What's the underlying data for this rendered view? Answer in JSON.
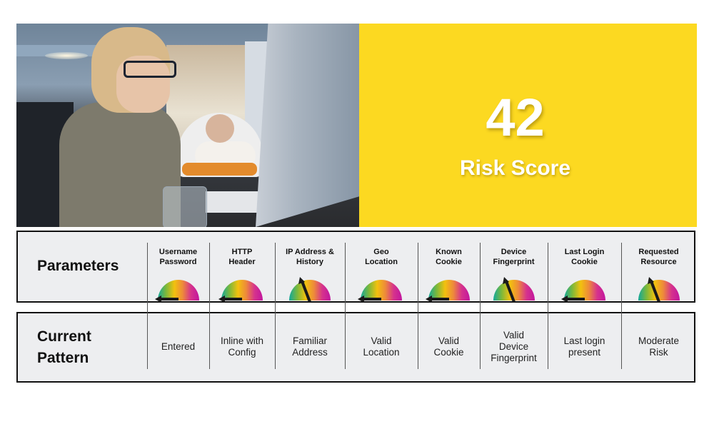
{
  "hero": {
    "image_description": "woman with glasses working at computer, baby in high chair in background"
  },
  "score": {
    "value": "42",
    "label": "Risk Score",
    "background_color": "#FCD921",
    "text_color": "#FFFFFF"
  },
  "parameters_row": {
    "title": "Parameters"
  },
  "pattern_row": {
    "title_line1": "Current",
    "title_line2": "Pattern"
  },
  "gauge_colors": [
    "#12A89A",
    "#7DB83A",
    "#F2C10E",
    "#EE8A3A",
    "#D6338C",
    "#C2169E"
  ],
  "columns": [
    {
      "head_line1": "Username",
      "head_line2": "Password",
      "value_line1": "Entered",
      "value_line2": "",
      "value_line3": "",
      "gauge_level": "low"
    },
    {
      "head_line1": "HTTP",
      "head_line2": "Header",
      "value_line1": "Inline with",
      "value_line2": "Config",
      "value_line3": "",
      "gauge_level": "low"
    },
    {
      "head_line1": "IP Address &",
      "head_line2": "History",
      "value_line1": "Familiar",
      "value_line2": "Address",
      "value_line3": "",
      "gauge_level": "moderate"
    },
    {
      "head_line1": "Geo",
      "head_line2": "Location",
      "value_line1": "Valid",
      "value_line2": "Location",
      "value_line3": "",
      "gauge_level": "low"
    },
    {
      "head_line1": "Known",
      "head_line2": "Cookie",
      "value_line1": "Valid",
      "value_line2": "Cookie",
      "value_line3": "",
      "gauge_level": "low"
    },
    {
      "head_line1": "Device",
      "head_line2": "Fingerprint",
      "value_line1": "Valid",
      "value_line2": "Device",
      "value_line3": "Fingerprint",
      "gauge_level": "moderate"
    },
    {
      "head_line1": "Last Login",
      "head_line2": "Cookie",
      "value_line1": "Last login",
      "value_line2": "present",
      "value_line3": "",
      "gauge_level": "low"
    },
    {
      "head_line1": "Requested",
      "head_line2": "Resource",
      "value_line1": "Moderate",
      "value_line2": "Risk",
      "value_line3": "",
      "gauge_level": "moderate"
    }
  ]
}
